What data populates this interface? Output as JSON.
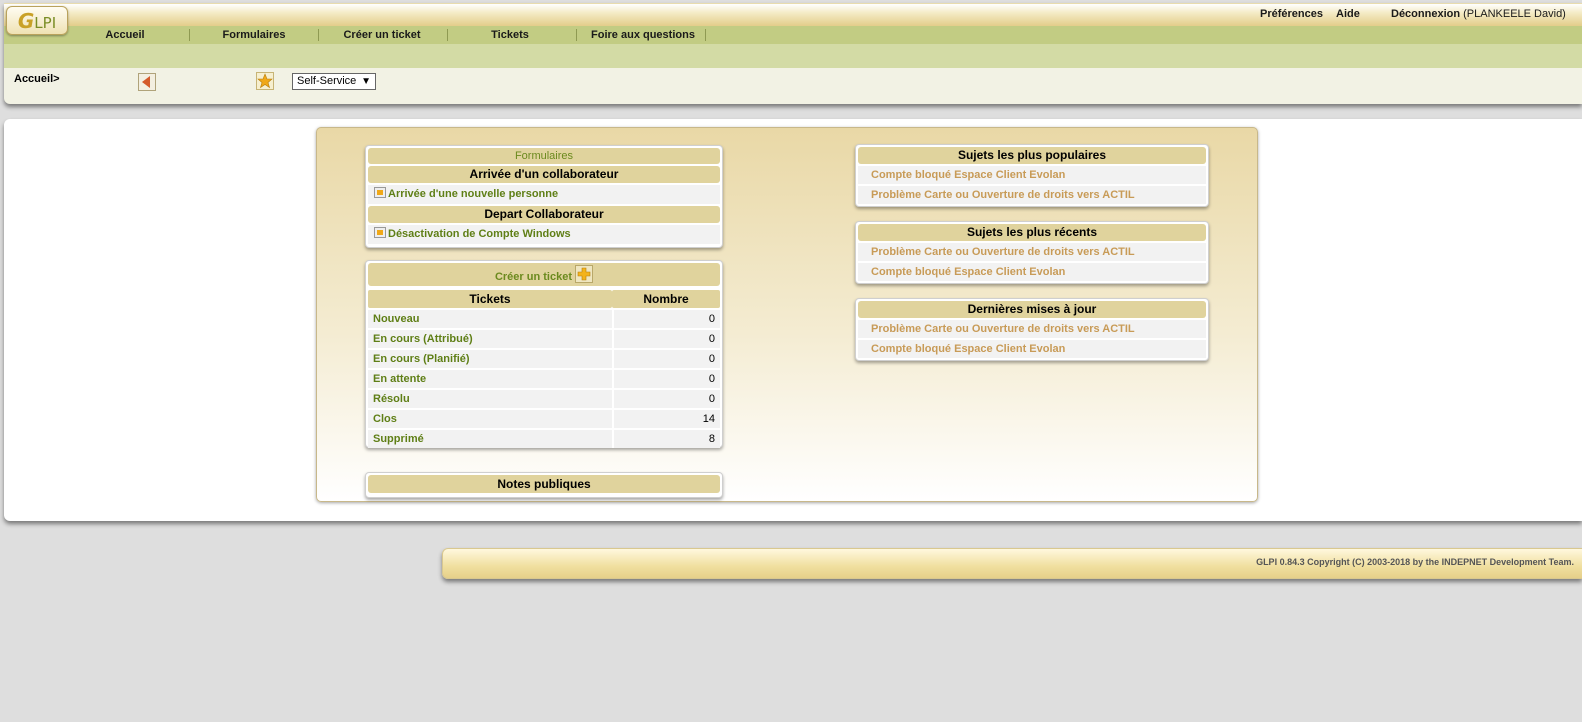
{
  "logo": {
    "text": "GLPI",
    "g": "G",
    "rest": "LPI"
  },
  "topnav": {
    "preferences": "Préférences",
    "help": "Aide",
    "logout": "Déconnexion",
    "user": "(PLANKEELE David)"
  },
  "menu": [
    "Accueil",
    "Formulaires",
    "Créer un ticket",
    "Tickets",
    "Foire aux questions"
  ],
  "breadcrumb": "Accueil>",
  "profile_select": {
    "value": "Self-Service"
  },
  "forms_panel": {
    "title": "Formulaires",
    "categories": [
      {
        "name": "Arrivée d'un collaborateur",
        "items": [
          "Arrivée d'une nouvelle personne"
        ]
      },
      {
        "name": "Depart Collaborateur",
        "items": [
          "Désactivation de Compte Windows"
        ]
      }
    ]
  },
  "tickets_panel": {
    "title": "Créer un ticket",
    "col_tickets": "Tickets",
    "col_count": "Nombre",
    "rows": [
      {
        "label": "Nouveau",
        "count": "0"
      },
      {
        "label": "En cours (Attribué)",
        "count": "0"
      },
      {
        "label": "En cours (Planifié)",
        "count": "0"
      },
      {
        "label": "En attente",
        "count": "0"
      },
      {
        "label": "Résolu",
        "count": "0"
      },
      {
        "label": "Clos",
        "count": "14"
      },
      {
        "label": "Supprimé",
        "count": "8"
      }
    ]
  },
  "notes_panel": {
    "title": "Notes publiques"
  },
  "popular": {
    "title": "Sujets les plus populaires",
    "items": [
      "Compte bloqué Espace Client Evolan",
      "Problème Carte ou Ouverture de droits vers ACTIL"
    ]
  },
  "recent": {
    "title": "Sujets les plus récents",
    "items": [
      "Problème Carte ou Ouverture de droits vers ACTIL",
      "Compte bloqué Espace Client Evolan"
    ]
  },
  "updates": {
    "title": "Dernières mises à jour",
    "items": [
      "Problème Carte ou Ouverture de droits vers ACTIL",
      "Compte bloqué Espace Client Evolan"
    ]
  },
  "footer": "GLPI 0.84.3 Copyright (C) 2003-2018 by the INDEPNET Development Team.",
  "colors": {
    "accent_green": "#5f7f16",
    "header_tan": "#e0d39d",
    "faq_link": "#c89b57",
    "menu_bar": "#c2cc83"
  }
}
